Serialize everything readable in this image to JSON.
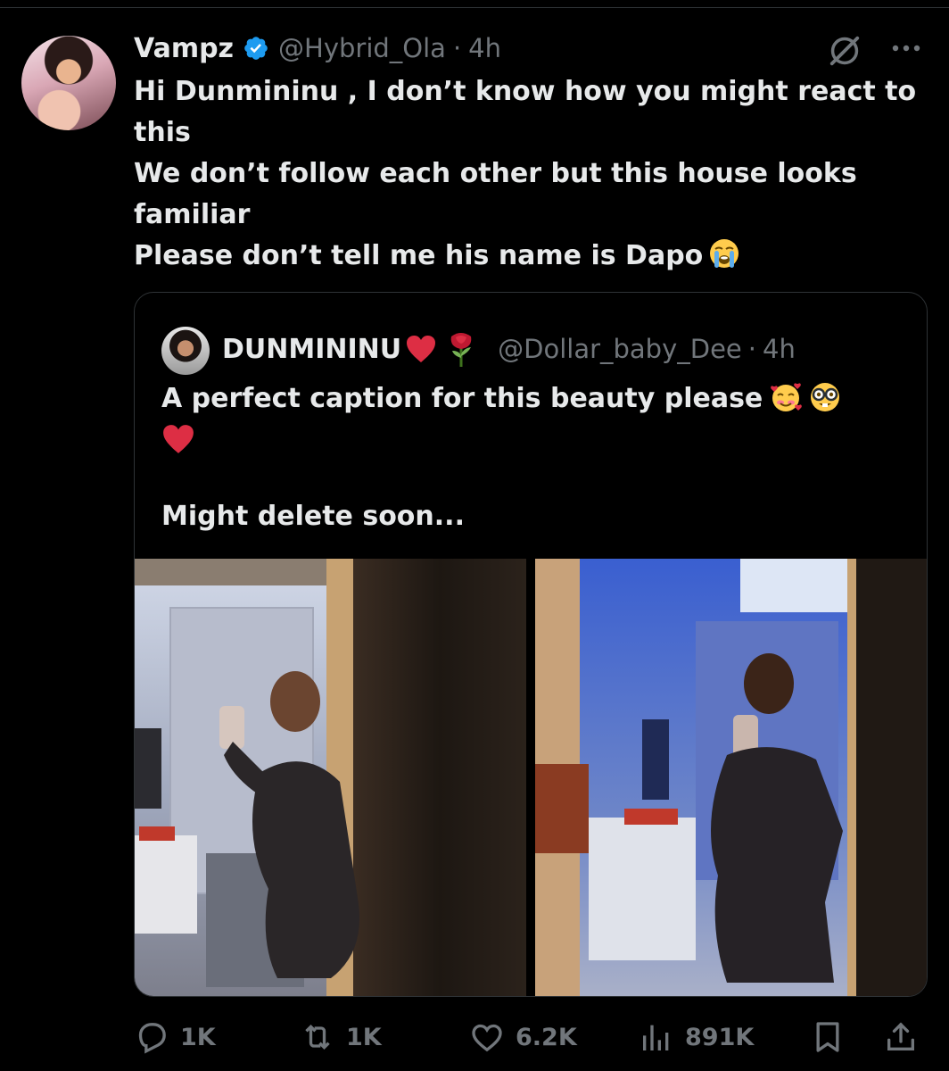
{
  "tweet": {
    "display_name": "Vampz",
    "handle": "@Hybrid_Ola",
    "separator": "·",
    "time": "4h",
    "lines": [
      "Hi Dunmininu , I don’t know how you might react to",
      "this",
      "We don’t follow each other but this house looks",
      "familiar",
      "Please don’t tell me his name is Dapo"
    ],
    "line_emoji": "loudly-crying-face-emoji"
  },
  "quote": {
    "display_name": "DUNMININU",
    "name_emojis": [
      "red-heart-emoji",
      "rose-emoji"
    ],
    "handle": "@Dollar_baby_Dee",
    "separator": "·",
    "time": "4h",
    "line1": "A perfect caption for this beauty please",
    "line1_emojis": [
      "smiling-face-with-hearts-emoji",
      "nerd-face-emoji"
    ],
    "line2_emoji": "red-heart-emoji",
    "line3": "Might delete soon..."
  },
  "actions": {
    "replies": "1K",
    "reposts": "1K",
    "likes": "6.2K",
    "views": "891K"
  },
  "colors": {
    "background": "#000000",
    "text": "#e7e9ea",
    "muted": "#71767b",
    "border": "#2f3336",
    "verified": "#1d9bf0"
  },
  "icons": [
    "grok-icon",
    "more-icon",
    "verified-icon",
    "reply-icon",
    "repost-icon",
    "like-icon",
    "views-icon",
    "bookmark-icon",
    "share-icon"
  ]
}
